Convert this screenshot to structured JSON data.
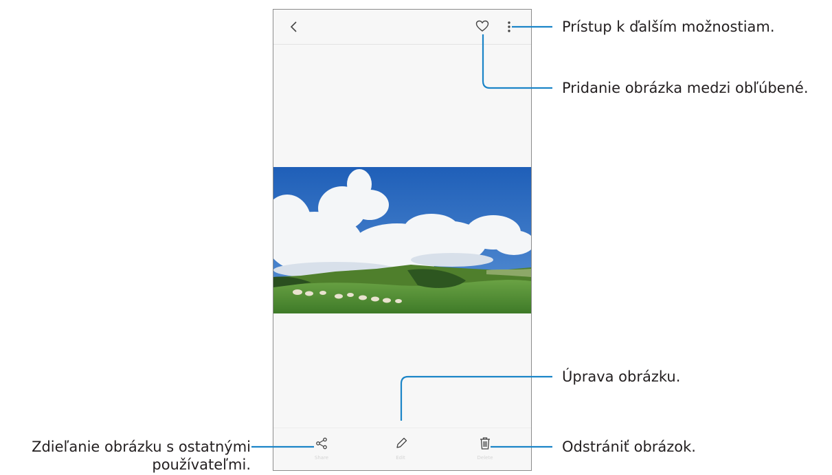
{
  "viewer": {
    "icons": {
      "back": "chevron-left-icon",
      "favorite": "heart-outline-icon",
      "more": "vertical-dots-icon",
      "share": "share-icon",
      "edit": "pencil-icon",
      "delete": "trash-icon"
    },
    "toolbar": {
      "share_label": "Share",
      "edit_label": "Edit",
      "delete_label": "Delete"
    }
  },
  "callouts": {
    "more_options": "Prístup k ďalším možnostiam.",
    "favorite": "Pridanie obrázka medzi obľúbené.",
    "edit": "Úprava obrázku.",
    "delete": "Odstrániť obrázok.",
    "share_line1": "Zdieľanie obrázku s ostatnými",
    "share_line2": "používateľmi."
  },
  "colors": {
    "callout_line": "#1a84c7",
    "text": "#231f20",
    "sky": "#2f6fc4",
    "grass": "#4f8f34"
  }
}
